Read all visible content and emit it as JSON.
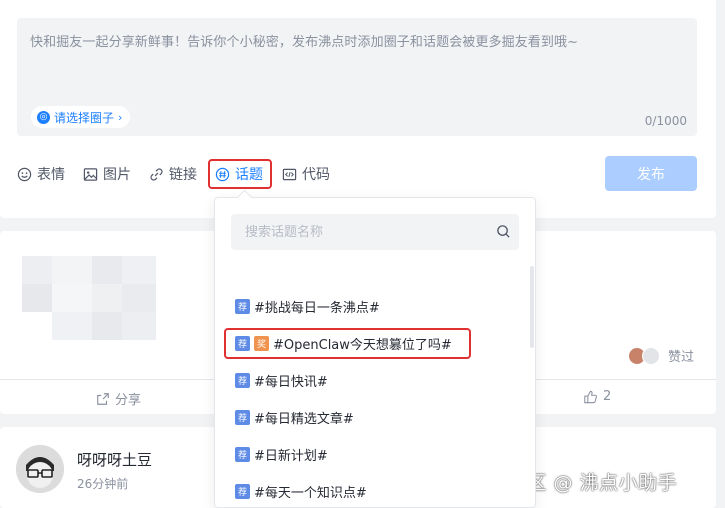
{
  "composer": {
    "placeholder": "快和掘友一起分享新鲜事！告诉你个小秘密，发布沸点时添加圈子和话题会被更多掘友看到哦~",
    "circle_button": "请选择圈子",
    "counter": "0/1000",
    "toolbar": {
      "emoji": "表情",
      "image": "图片",
      "link": "链接",
      "topic": "话题",
      "code": "代码"
    },
    "publish": "发布"
  },
  "dropdown": {
    "search_placeholder": "搜索话题名称",
    "badge_recommend": "荐",
    "badge_prize": "奖",
    "topics": [
      {
        "name": "#挑战每日一条沸点#",
        "prize": false
      },
      {
        "name": "#OpenClaw今天想篡位了吗#",
        "prize": true
      },
      {
        "name": "#每日快讯#",
        "prize": false
      },
      {
        "name": "#每日精选文章#",
        "prize": false
      },
      {
        "name": "#日新计划#",
        "prize": false
      },
      {
        "name": "#每天一个知识点#",
        "prize": false
      }
    ]
  },
  "feed": {
    "post1": {
      "likes_text": "赞过",
      "share": "分享",
      "like_count": "2"
    },
    "post2": {
      "username": "呀呀呀土豆",
      "time": "26分钟前"
    }
  },
  "watermark": "掘金技术社区 @ 沸点小助手",
  "colors": {
    "accent": "#1e80ff",
    "highlight": "#e03030",
    "publish_disabled": "#abcdff"
  }
}
